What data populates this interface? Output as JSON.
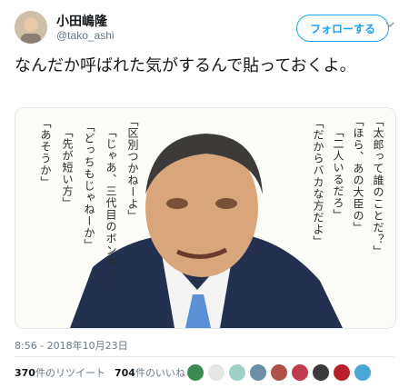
{
  "author": {
    "display_name": "小田嶋隆",
    "handle": "@tako_ashi"
  },
  "follow_label": "フォローする",
  "tweet": {
    "text": "なんだか呼ばれた気がするんで貼っておくよ。"
  },
  "image_text": [
    "「太郎って誰のことだ？」",
    "「ほら、あの大臣の」",
    "「二人いるだろ」",
    "「だからバカな方だよ」",
    "「区別つかねーよ」",
    "「じゃあ、三代目のボンボン」",
    "「どっちもじゃねーか」",
    "「先が短い方」",
    "「あそうか」"
  ],
  "timestamp": "8:56 - 2018年10月23日",
  "stats": {
    "retweets_count": "370",
    "retweets_label": "件のリツイート",
    "likes_count": "704",
    "likes_label": "件のいいね"
  },
  "colors": {
    "accent": "#1da1f2",
    "secondary_text": "#657786",
    "suit": "#23304f",
    "tie": "#5b8fd6"
  },
  "liker_avatars": [
    "#3e8a54",
    "#e6e6e6",
    "#9ed0c8",
    "#6b8fa8",
    "#b0524a",
    "#c23b4e",
    "#3a3a3a",
    "#b8202a",
    "#49a7d8"
  ]
}
